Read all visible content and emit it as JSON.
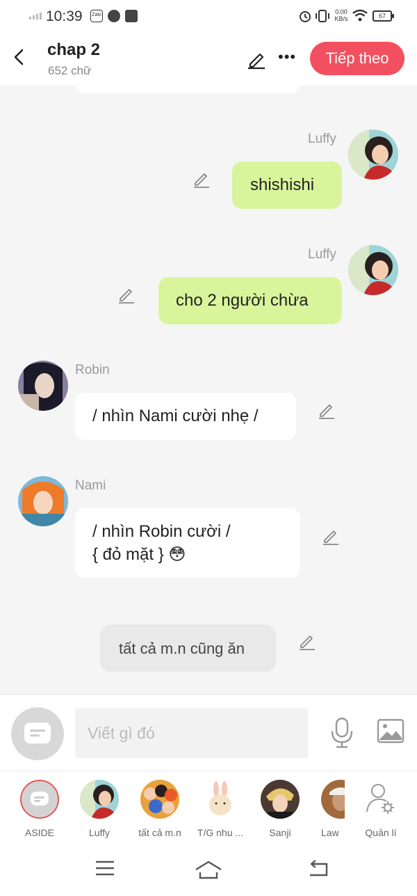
{
  "status_bar": {
    "time": "10:39",
    "zalo_label": "Zalo",
    "net_speed": "0.00",
    "net_unit": "KB/s",
    "battery": "67"
  },
  "header": {
    "title": "chap 2",
    "word_count": "652 chữ",
    "next_label": "Tiếp theo"
  },
  "messages": [
    {
      "sender": "Luffy",
      "text": "shishishi",
      "side": "right"
    },
    {
      "sender": "Luffy",
      "text": "cho 2 người chừa",
      "side": "right"
    },
    {
      "sender": "Robin",
      "text": "/ nhìn Nami cười nhẹ /",
      "side": "left"
    },
    {
      "sender": "Nami",
      "line1": "/ nhìn Robin cười /",
      "line2": "{ đỏ mặt } 😳",
      "side": "left"
    },
    {
      "text": "tất cả m.n cũng ăn",
      "side": "narration"
    }
  ],
  "composer": {
    "placeholder": "Viết gì đó"
  },
  "roles": [
    {
      "label": "ASIDE"
    },
    {
      "label": "Luffy"
    },
    {
      "label": "tất cả m.n"
    },
    {
      "label": "T/G nhu ..."
    },
    {
      "label": "Sanji"
    },
    {
      "label": "Law"
    },
    {
      "label": "Quản lí"
    }
  ],
  "colors": {
    "accent": "#f25060",
    "bubble_green": "#d9f59c",
    "background": "#f5f5f5"
  }
}
